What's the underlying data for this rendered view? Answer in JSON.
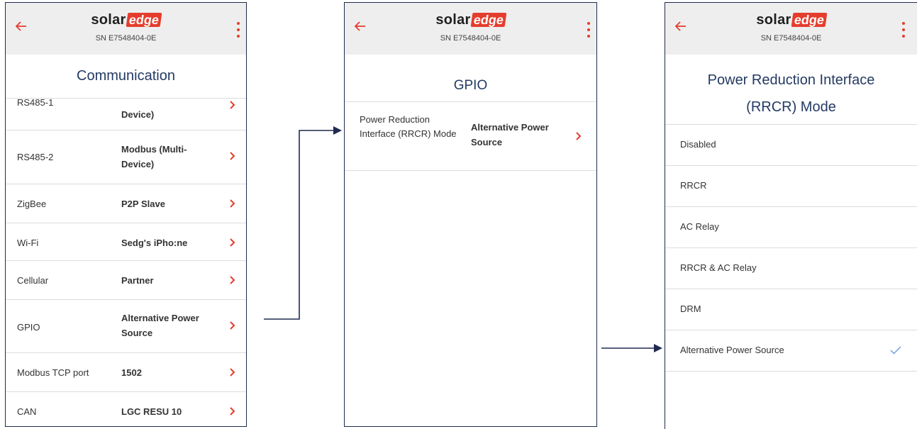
{
  "brand": {
    "logo_part1": "solar",
    "logo_part2": "edge",
    "serial": "SN E7548404-0E"
  },
  "icons": {
    "back": "arrow-left-icon",
    "menu": "more-vertical-icon",
    "chevron": "chevron-right-icon",
    "check": "checkmark-icon"
  },
  "colors": {
    "accent": "#e53d2d",
    "title": "#243a63",
    "check": "#6f9ee0",
    "frame": "#1f2b4f"
  },
  "screen1": {
    "title": "Communication",
    "rows": [
      {
        "label": "RS485-1",
        "value": "Device)"
      },
      {
        "label": "RS485-2",
        "value": "Modbus (Multi-Device)"
      },
      {
        "label": "ZigBee",
        "value": "P2P Slave"
      },
      {
        "label": "Wi-Fi",
        "value": "Sedg's iPho:ne"
      },
      {
        "label": "Cellular",
        "value": "Partner"
      },
      {
        "label": "GPIO",
        "value": "Alternative Power Source"
      },
      {
        "label": "Modbus TCP port",
        "value": "1502"
      },
      {
        "label": "CAN",
        "value": "LGC RESU 10"
      }
    ]
  },
  "screen2": {
    "title": "GPIO",
    "rows": [
      {
        "label": "Power Reduction Interface (RRCR) Mode",
        "value": "Alternative Power Source"
      }
    ]
  },
  "screen3": {
    "title": "Power Reduction Interface (RRCR) Mode",
    "options": [
      "Disabled",
      "RRCR",
      "AC Relay",
      "RRCR & AC Relay",
      "DRM",
      "Alternative Power Source"
    ],
    "selected": "Alternative Power Source"
  }
}
